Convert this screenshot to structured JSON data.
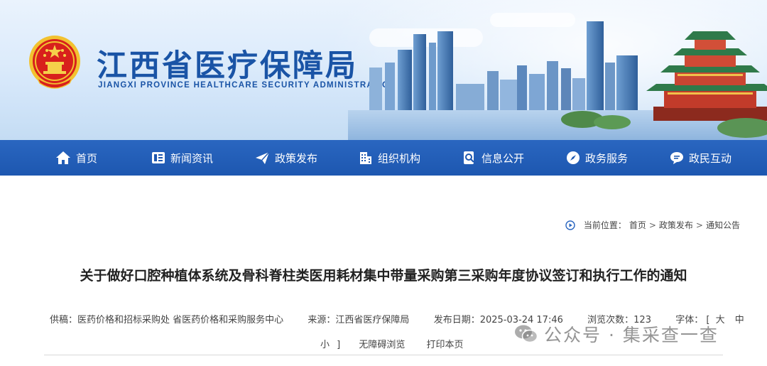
{
  "banner": {
    "title": "江西省医疗保障局",
    "subtitle": "JIANGXI PROVINCE HEALTHCARE SECURITY ADMINISTRATION"
  },
  "nav": {
    "items": [
      {
        "label": "首页",
        "icon": "home-icon"
      },
      {
        "label": "新闻资讯",
        "icon": "news-icon"
      },
      {
        "label": "政策发布",
        "icon": "paper-plane-icon"
      },
      {
        "label": "组织机构",
        "icon": "building-icon"
      },
      {
        "label": "信息公开",
        "icon": "info-search-icon"
      },
      {
        "label": "政务服务",
        "icon": "compass-icon"
      },
      {
        "label": "政民互动",
        "icon": "chat-icon"
      }
    ]
  },
  "breadcrumb": {
    "prefix": "当前位置：",
    "items": [
      "首页",
      "政策发布",
      "通知公告"
    ],
    "separator": ">"
  },
  "article": {
    "title": "关于做好口腔种植体系统及骨科脊柱类医用耗材集中带量采购第三采购年度协议签订和执行工作的通知",
    "meta": {
      "supplier": "供稿：医药价格和招标采购处 省医药价格和采购服务中心",
      "source": "来源：江西省医疗保障局",
      "publish_date": "发布日期：2025-03-24 17:46",
      "views": "浏览次数：123",
      "font_label": "字体：",
      "font_open": "[",
      "font_large": "大",
      "font_medium": "中",
      "font_small": "小",
      "font_close": "]",
      "accessible": "无障碍浏览",
      "print": "打印本页"
    }
  },
  "watermark": {
    "text": "公众号 · 集采查一查"
  },
  "colors": {
    "brand_blue": "#1a54a6",
    "nav_blue": "#1d57b0"
  }
}
